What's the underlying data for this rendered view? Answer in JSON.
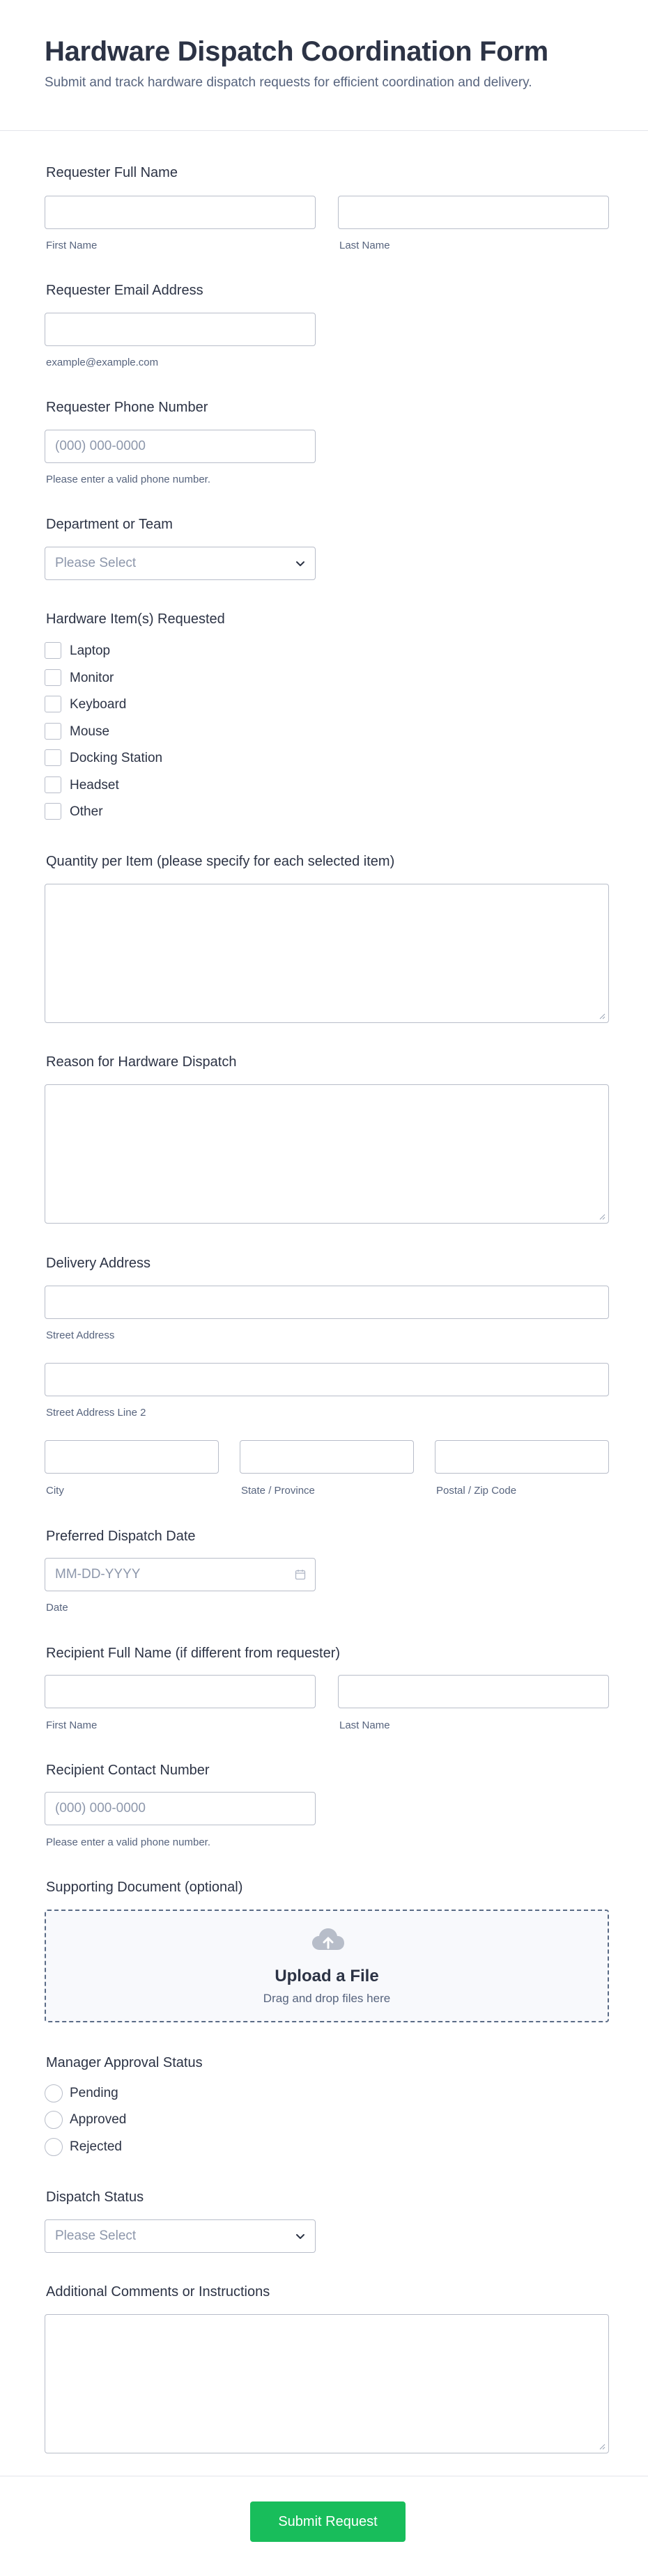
{
  "header": {
    "title": "Hardware Dispatch Coordination Form",
    "subtitle": "Submit and track hardware dispatch requests for efficient coordination and delivery."
  },
  "requester_name": {
    "label": "Requester Full Name",
    "first_sublabel": "First Name",
    "last_sublabel": "Last Name"
  },
  "requester_email": {
    "label": "Requester Email Address",
    "sublabel": "example@example.com"
  },
  "requester_phone": {
    "label": "Requester Phone Number",
    "placeholder": "(000) 000-0000",
    "sublabel": "Please enter a valid phone number."
  },
  "department": {
    "label": "Department or Team",
    "placeholder": "Please Select"
  },
  "hardware": {
    "label": "Hardware Item(s) Requested",
    "options": [
      "Laptop",
      "Monitor",
      "Keyboard",
      "Mouse",
      "Docking Station",
      "Headset",
      "Other"
    ]
  },
  "quantity": {
    "label": "Quantity per Item (please specify for each selected item)"
  },
  "reason": {
    "label": "Reason for Hardware Dispatch"
  },
  "address": {
    "label": "Delivery Address",
    "street_sublabel": "Street Address",
    "street2_sublabel": "Street Address Line 2",
    "city_sublabel": "City",
    "state_sublabel": "State / Province",
    "zip_sublabel": "Postal / Zip Code"
  },
  "dispatch_date": {
    "label": "Preferred Dispatch Date",
    "placeholder": "MM-DD-YYYY",
    "sublabel": "Date"
  },
  "recipient_name": {
    "label": "Recipient Full Name (if different from requester)",
    "first_sublabel": "First Name",
    "last_sublabel": "Last Name"
  },
  "recipient_phone": {
    "label": "Recipient Contact Number",
    "placeholder": "(000) 000-0000",
    "sublabel": "Please enter a valid phone number."
  },
  "supporting_doc": {
    "label": "Supporting Document (optional)",
    "upload_title": "Upload a File",
    "upload_sub": "Drag and drop files here"
  },
  "manager_approval": {
    "label": "Manager Approval Status",
    "options": [
      "Pending",
      "Approved",
      "Rejected"
    ]
  },
  "dispatch_status": {
    "label": "Dispatch Status",
    "placeholder": "Please Select"
  },
  "comments": {
    "label": "Additional Comments or Instructions"
  },
  "submit": {
    "label": "Submit Request",
    "color": "#18bd5b"
  },
  "icons": {
    "select": "chevron-down-icon",
    "date": "calendar-icon",
    "upload": "cloud-upload-icon",
    "textarea": "resize-grip-icon"
  }
}
